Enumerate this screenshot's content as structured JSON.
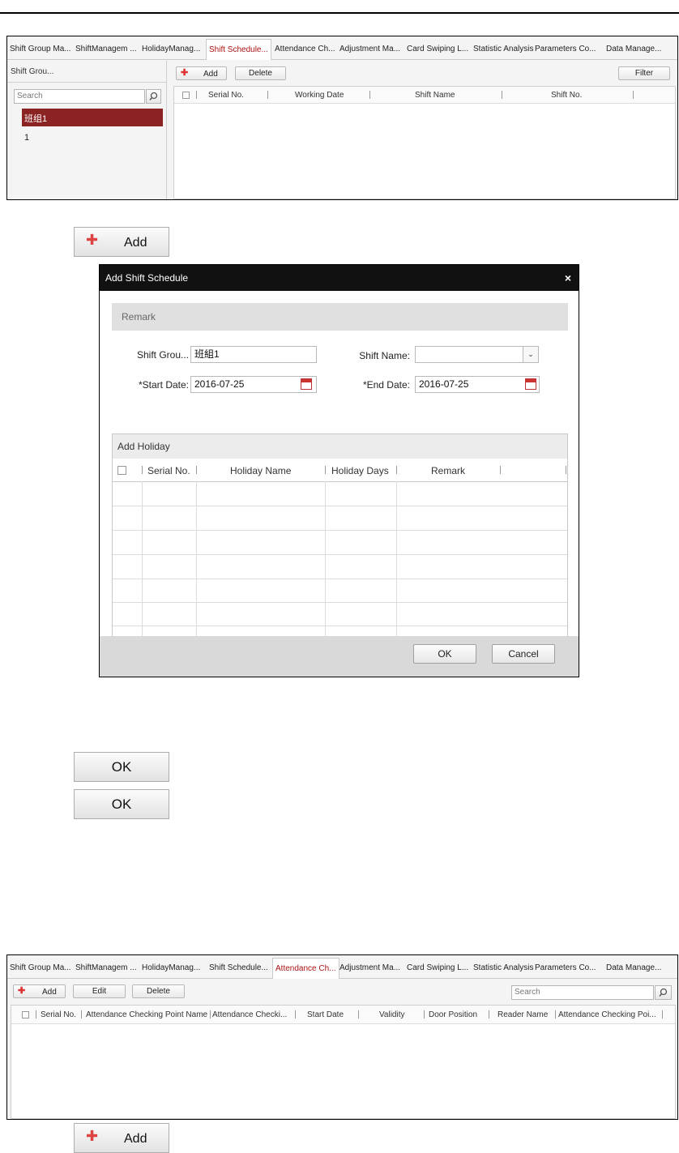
{
  "screen1": {
    "tabs": [
      "Shift Group Ma...",
      "ShiftManagem ...",
      "HolidayManag...",
      "Shift Schedule...",
      "Attendance Ch...",
      "Adjustment Ma...",
      "Card Swiping L...",
      "Statistic Analysis",
      "Parameters Co...",
      "Data Manage..."
    ],
    "active_tab": "Shift Schedule...",
    "left_header": "Shift Grou...",
    "search_placeholder": "Search",
    "group_items": [
      "班组1",
      "1"
    ],
    "toolbar": {
      "add": "Add",
      "delete": "Delete",
      "filter": "Filter"
    },
    "columns": [
      "Serial No.",
      "Working Date",
      "Shift Name",
      "Shift No."
    ]
  },
  "standalone_buttons": {
    "add1": "Add",
    "ok1": "OK",
    "ok2": "OK",
    "add2": "Add"
  },
  "dialog": {
    "title": "Add Shift Schedule",
    "close": "×",
    "remark_banner": "Remark",
    "shift_group_label": "Shift Grou...",
    "shift_group_value": "班組1",
    "shift_name_label": "Shift Name:",
    "shift_name_value": "",
    "start_date_label": "*Start Date:",
    "start_date_value": "2016-07-25",
    "end_date_label": "*End Date:",
    "end_date_value": "2016-07-25",
    "holiday_section": "Add Holiday",
    "holiday_columns": [
      "Serial No.",
      "Holiday Name",
      "Holiday Days",
      "Remark"
    ],
    "ok": "OK",
    "cancel": "Cancel"
  },
  "screen2": {
    "tabs": [
      "Shift Group Ma...",
      "ShiftManagem ...",
      "HolidayManag...",
      "Shift Schedule...",
      "Attendance Ch...",
      "Adjustment Ma...",
      "Card Swiping L...",
      "Statistic Analysis",
      "Parameters Co...",
      "Data Manage..."
    ],
    "active_tab": "Attendance Ch...",
    "toolbar": {
      "add": "Add",
      "edit": "Edit",
      "delete": "Delete"
    },
    "search_placeholder": "Search",
    "columns": [
      "Serial No.",
      "Attendance Checking Point Name",
      "Attendance Checki...",
      "Start Date",
      "Validity",
      "Door Position",
      "Reader Name",
      "Attendance Checking Poi..."
    ]
  }
}
